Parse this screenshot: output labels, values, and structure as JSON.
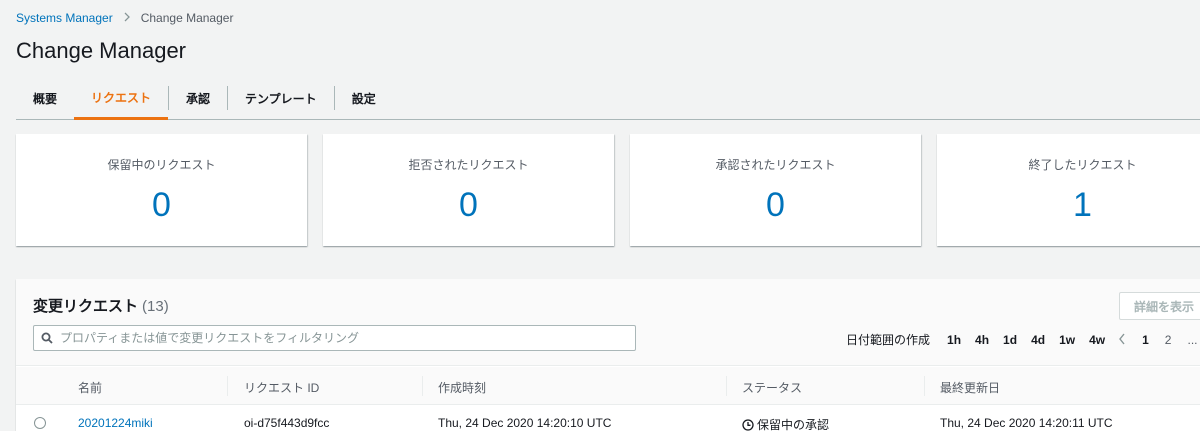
{
  "breadcrumb": {
    "parent": "Systems Manager",
    "current": "Change Manager"
  },
  "page_title": "Change Manager",
  "tabs": [
    {
      "label": "概要"
    },
    {
      "label": "リクエスト"
    },
    {
      "label": "承認"
    },
    {
      "label": "テンプレート"
    },
    {
      "label": "設定"
    }
  ],
  "active_tab": "リクエスト",
  "summary_cards": [
    {
      "title": "保留中のリクエスト",
      "value": "0"
    },
    {
      "title": "拒否されたリクエスト",
      "value": "0"
    },
    {
      "title": "承認されたリクエスト",
      "value": "0"
    },
    {
      "title": "終了したリクエスト",
      "value": "1"
    }
  ],
  "table": {
    "title": "変更リクエスト",
    "count": "(13)",
    "details_button": "詳細を表示",
    "filter_placeholder": "プロパティまたは値で変更リクエストをフィルタリング",
    "range_label": "日付範囲の作成",
    "range_options": [
      "1h",
      "4h",
      "1d",
      "4d",
      "1w",
      "4w"
    ],
    "pages": [
      "1",
      "2",
      "..."
    ],
    "columns": [
      "名前",
      "リクエスト ID",
      "作成時刻",
      "ステータス",
      "最終更新日"
    ],
    "rows": [
      {
        "name": "20201224miki",
        "request_id": "oi-d75f443d9fcc",
        "created": "Thu, 24 Dec 2020 14:20:10 UTC",
        "status": "保留中の承認",
        "updated": "Thu, 24 Dec 2020 14:20:11 UTC"
      }
    ]
  },
  "colors": {
    "accent": "#ec7211",
    "link": "#0073bb",
    "background": "#f2f3f3"
  }
}
